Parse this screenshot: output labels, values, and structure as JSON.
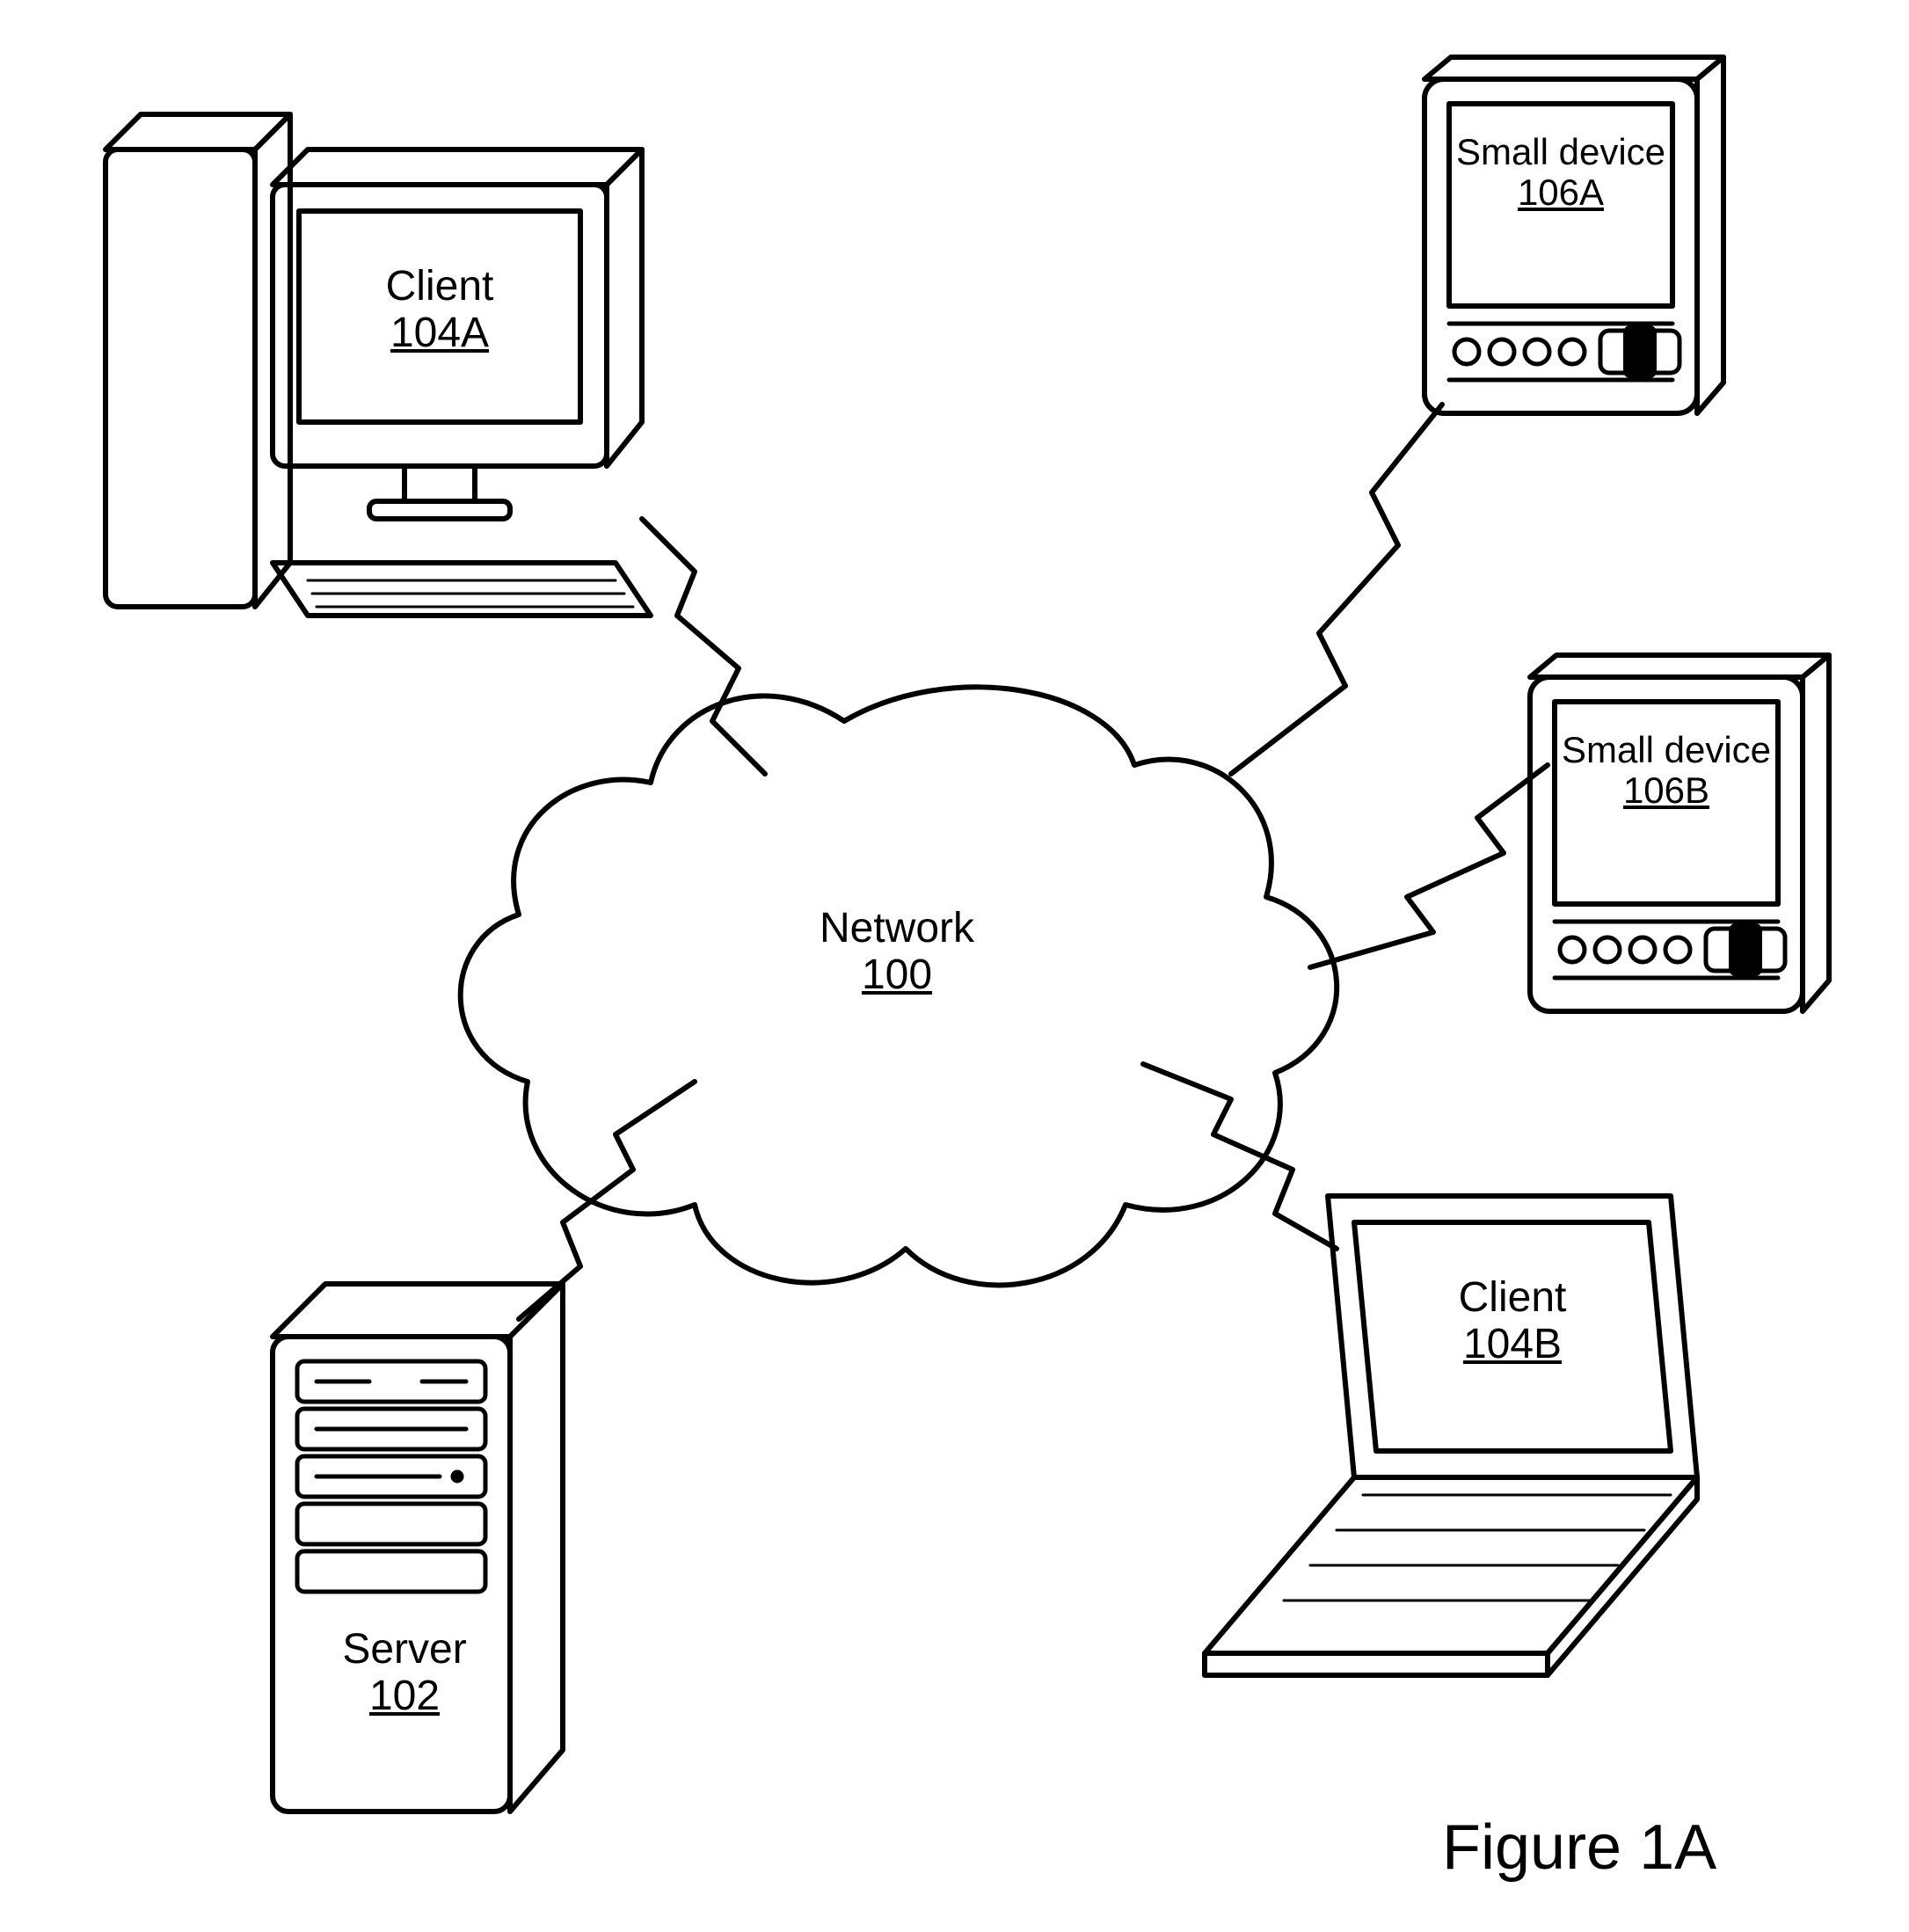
{
  "figure_caption": "Figure 1A",
  "nodes": {
    "network": {
      "name": "Network",
      "num": "100"
    },
    "server": {
      "name": "Server",
      "num": "102"
    },
    "clientA": {
      "name": "Client",
      "num": "104A"
    },
    "clientB": {
      "name": "Client",
      "num": "104B"
    },
    "deviceA": {
      "name": "Small device",
      "num": "106A"
    },
    "deviceB": {
      "name": "Small device",
      "num": "106B"
    }
  }
}
